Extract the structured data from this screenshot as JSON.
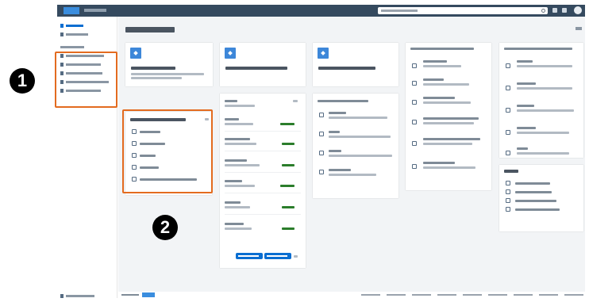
{
  "window": {
    "title": ""
  },
  "shell": {
    "search_placeholder": ""
  },
  "sidebar": {
    "items": [
      {
        "label": ""
      },
      {
        "label": ""
      },
      {
        "label": ""
      },
      {
        "label": ""
      },
      {
        "label": ""
      },
      {
        "label": ""
      },
      {
        "label": ""
      },
      {
        "label": ""
      }
    ],
    "footer_label": ""
  },
  "main": {
    "welcome": "",
    "launch_tiles": [
      {
        "title": "",
        "subtitle": ""
      },
      {
        "title": ""
      },
      {
        "title": ""
      }
    ],
    "shortcuts_card": {
      "header": "",
      "items": [
        {
          "label": ""
        },
        {
          "label": ""
        },
        {
          "label": ""
        },
        {
          "label": ""
        },
        {
          "label": ""
        }
      ]
    },
    "tasks_card": {
      "header": "",
      "items": [
        {
          "title": "",
          "value": ""
        },
        {
          "title": "",
          "value": ""
        },
        {
          "title": "",
          "value": ""
        },
        {
          "title": "",
          "value": ""
        },
        {
          "title": "",
          "value": ""
        },
        {
          "title": "",
          "value": ""
        }
      ],
      "buttons": [
        "",
        ""
      ]
    },
    "recent_card": {
      "header": "",
      "items": [
        {
          "label": ""
        },
        {
          "label": ""
        },
        {
          "label": ""
        },
        {
          "label": ""
        },
        {
          "label": ""
        }
      ]
    },
    "list_card_a": {
      "header": "",
      "items": [
        {
          "label": ""
        },
        {
          "label": ""
        },
        {
          "label": ""
        },
        {
          "label": ""
        },
        {
          "label": ""
        },
        {
          "label": ""
        }
      ]
    },
    "list_card_b": {
      "header": "",
      "items": [
        {
          "label": ""
        },
        {
          "label": ""
        },
        {
          "label": ""
        },
        {
          "label": ""
        },
        {
          "label": ""
        }
      ]
    },
    "list_card_c": {
      "header": "",
      "items": [
        {
          "label": ""
        },
        {
          "label": ""
        },
        {
          "label": ""
        },
        {
          "label": ""
        }
      ]
    }
  },
  "footer": {
    "links": ""
  },
  "annotations": {
    "marker_1": "1",
    "marker_2": "2",
    "highlight_color": "#e36b1f"
  },
  "colors": {
    "shell": "#354a5f",
    "accent": "#0a6ed1",
    "tile": "#3d87d9",
    "success": "#2b7d2b",
    "background": "#f2f4f6"
  }
}
